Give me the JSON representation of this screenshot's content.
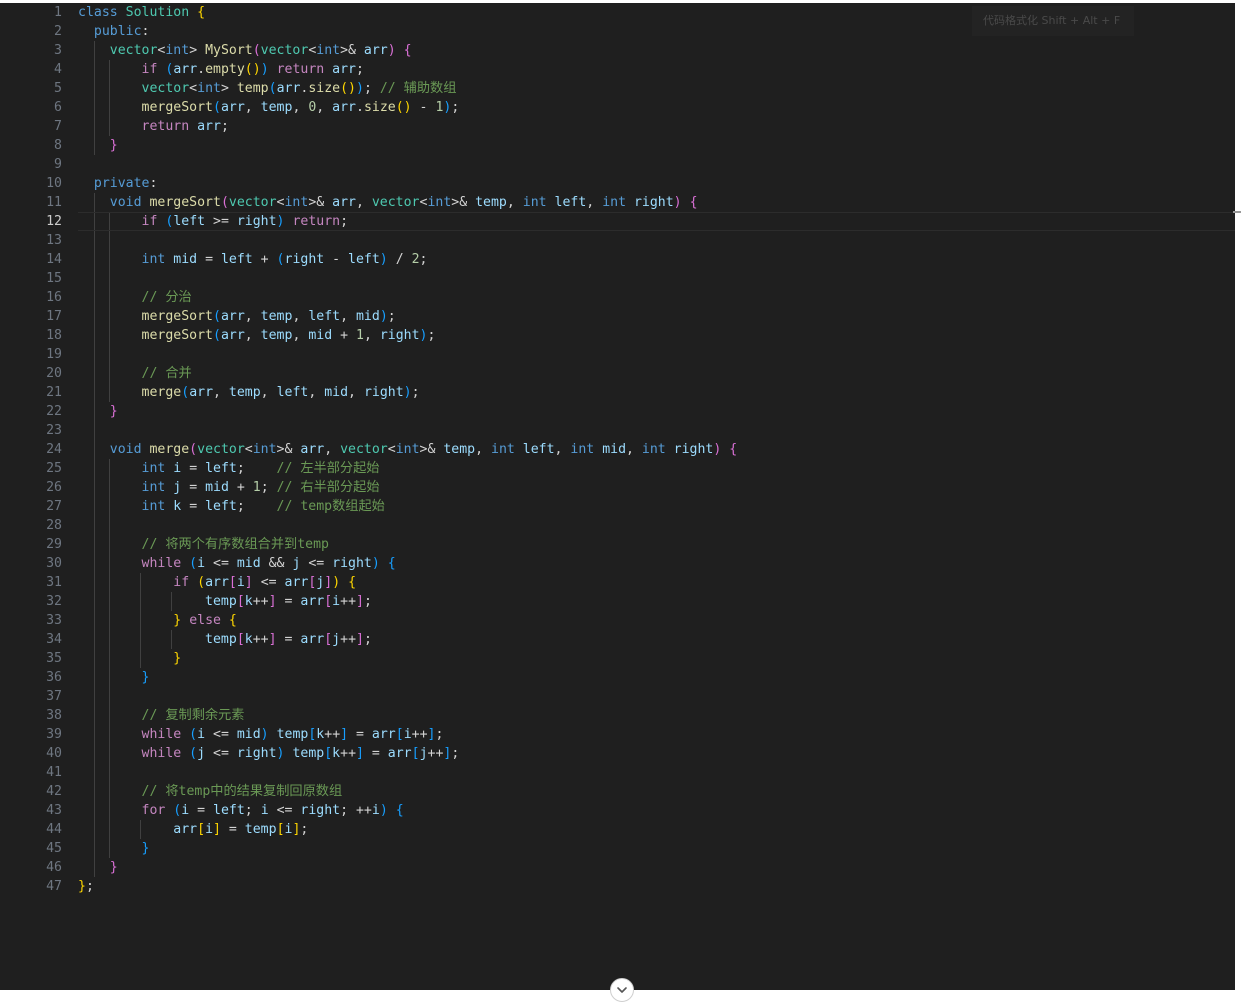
{
  "editor": {
    "hint_text": "代码格式化 Shift + Alt + F",
    "active_line": 12,
    "lines": [
      [
        [
          "kw",
          "class "
        ],
        [
          "typ",
          "Solution "
        ],
        [
          "p1",
          "{"
        ]
      ],
      [
        [
          "op",
          "  "
        ],
        [
          "kw",
          "public"
        ],
        [
          "op",
          ":"
        ]
      ],
      [
        [
          "op",
          "    "
        ],
        [
          "typ",
          "vector"
        ],
        [
          "op",
          "<"
        ],
        [
          "kw",
          "int"
        ],
        [
          "op",
          "> "
        ],
        [
          "fn",
          "MySort"
        ],
        [
          "p2",
          "("
        ],
        [
          "typ",
          "vector"
        ],
        [
          "op",
          "<"
        ],
        [
          "kw",
          "int"
        ],
        [
          "op",
          ">& "
        ],
        [
          "var",
          "arr"
        ],
        [
          "p2",
          ")"
        ],
        [
          "op",
          " "
        ],
        [
          "p2",
          "{"
        ]
      ],
      [
        [
          "op",
          "        "
        ],
        [
          "ctl",
          "if "
        ],
        [
          "p3",
          "("
        ],
        [
          "var",
          "arr"
        ],
        [
          "op",
          "."
        ],
        [
          "fn",
          "empty"
        ],
        [
          "p1",
          "()"
        ],
        [
          "p3",
          ")"
        ],
        [
          "op",
          " "
        ],
        [
          "ctl",
          "return "
        ],
        [
          "var",
          "arr"
        ],
        [
          "op",
          ";"
        ]
      ],
      [
        [
          "op",
          "        "
        ],
        [
          "typ",
          "vector"
        ],
        [
          "op",
          "<"
        ],
        [
          "kw",
          "int"
        ],
        [
          "op",
          "> "
        ],
        [
          "fn",
          "temp"
        ],
        [
          "p3",
          "("
        ],
        [
          "var",
          "arr"
        ],
        [
          "op",
          "."
        ],
        [
          "fn",
          "size"
        ],
        [
          "p1",
          "()"
        ],
        [
          "p3",
          ")"
        ],
        [
          "op",
          "; "
        ],
        [
          "cm",
          "// 辅助数组"
        ]
      ],
      [
        [
          "op",
          "        "
        ],
        [
          "fn",
          "mergeSort"
        ],
        [
          "p3",
          "("
        ],
        [
          "var",
          "arr"
        ],
        [
          "op",
          ", "
        ],
        [
          "var",
          "temp"
        ],
        [
          "op",
          ", "
        ],
        [
          "num",
          "0"
        ],
        [
          "op",
          ", "
        ],
        [
          "var",
          "arr"
        ],
        [
          "op",
          "."
        ],
        [
          "fn",
          "size"
        ],
        [
          "p1",
          "()"
        ],
        [
          "op",
          " - "
        ],
        [
          "num",
          "1"
        ],
        [
          "p3",
          ")"
        ],
        [
          "op",
          ";"
        ]
      ],
      [
        [
          "op",
          "        "
        ],
        [
          "ctl",
          "return "
        ],
        [
          "var",
          "arr"
        ],
        [
          "op",
          ";"
        ]
      ],
      [
        [
          "op",
          "    "
        ],
        [
          "p2",
          "}"
        ]
      ],
      [],
      [
        [
          "op",
          "  "
        ],
        [
          "kw",
          "private"
        ],
        [
          "op",
          ":"
        ]
      ],
      [
        [
          "op",
          "    "
        ],
        [
          "kw",
          "void "
        ],
        [
          "fn",
          "mergeSort"
        ],
        [
          "p2",
          "("
        ],
        [
          "typ",
          "vector"
        ],
        [
          "op",
          "<"
        ],
        [
          "kw",
          "int"
        ],
        [
          "op",
          ">& "
        ],
        [
          "var",
          "arr"
        ],
        [
          "op",
          ", "
        ],
        [
          "typ",
          "vector"
        ],
        [
          "op",
          "<"
        ],
        [
          "kw",
          "int"
        ],
        [
          "op",
          ">& "
        ],
        [
          "var",
          "temp"
        ],
        [
          "op",
          ", "
        ],
        [
          "kw",
          "int "
        ],
        [
          "var",
          "left"
        ],
        [
          "op",
          ", "
        ],
        [
          "kw",
          "int "
        ],
        [
          "var",
          "right"
        ],
        [
          "p2",
          ")"
        ],
        [
          "op",
          " "
        ],
        [
          "p2",
          "{"
        ]
      ],
      [
        [
          "op",
          "        "
        ],
        [
          "ctl",
          "if "
        ],
        [
          "p3",
          "("
        ],
        [
          "var",
          "left"
        ],
        [
          "op",
          " >= "
        ],
        [
          "var",
          "right"
        ],
        [
          "p3",
          ")"
        ],
        [
          "op",
          " "
        ],
        [
          "ctl",
          "return"
        ],
        [
          "op",
          ";"
        ]
      ],
      [],
      [
        [
          "op",
          "        "
        ],
        [
          "kw",
          "int "
        ],
        [
          "var",
          "mid"
        ],
        [
          "op",
          " = "
        ],
        [
          "var",
          "left"
        ],
        [
          "op",
          " + "
        ],
        [
          "p3",
          "("
        ],
        [
          "var",
          "right"
        ],
        [
          "op",
          " - "
        ],
        [
          "var",
          "left"
        ],
        [
          "p3",
          ")"
        ],
        [
          "op",
          " / "
        ],
        [
          "num",
          "2"
        ],
        [
          "op",
          ";"
        ]
      ],
      [],
      [
        [
          "op",
          "        "
        ],
        [
          "cm",
          "// 分治"
        ]
      ],
      [
        [
          "op",
          "        "
        ],
        [
          "fn",
          "mergeSort"
        ],
        [
          "p3",
          "("
        ],
        [
          "var",
          "arr"
        ],
        [
          "op",
          ", "
        ],
        [
          "var",
          "temp"
        ],
        [
          "op",
          ", "
        ],
        [
          "var",
          "left"
        ],
        [
          "op",
          ", "
        ],
        [
          "var",
          "mid"
        ],
        [
          "p3",
          ")"
        ],
        [
          "op",
          ";"
        ]
      ],
      [
        [
          "op",
          "        "
        ],
        [
          "fn",
          "mergeSort"
        ],
        [
          "p3",
          "("
        ],
        [
          "var",
          "arr"
        ],
        [
          "op",
          ", "
        ],
        [
          "var",
          "temp"
        ],
        [
          "op",
          ", "
        ],
        [
          "var",
          "mid"
        ],
        [
          "op",
          " + "
        ],
        [
          "num",
          "1"
        ],
        [
          "op",
          ", "
        ],
        [
          "var",
          "right"
        ],
        [
          "p3",
          ")"
        ],
        [
          "op",
          ";"
        ]
      ],
      [],
      [
        [
          "op",
          "        "
        ],
        [
          "cm",
          "// 合并"
        ]
      ],
      [
        [
          "op",
          "        "
        ],
        [
          "fn",
          "merge"
        ],
        [
          "p3",
          "("
        ],
        [
          "var",
          "arr"
        ],
        [
          "op",
          ", "
        ],
        [
          "var",
          "temp"
        ],
        [
          "op",
          ", "
        ],
        [
          "var",
          "left"
        ],
        [
          "op",
          ", "
        ],
        [
          "var",
          "mid"
        ],
        [
          "op",
          ", "
        ],
        [
          "var",
          "right"
        ],
        [
          "p3",
          ")"
        ],
        [
          "op",
          ";"
        ]
      ],
      [
        [
          "op",
          "    "
        ],
        [
          "p2",
          "}"
        ]
      ],
      [],
      [
        [
          "op",
          "    "
        ],
        [
          "kw",
          "void "
        ],
        [
          "fn",
          "merge"
        ],
        [
          "p2",
          "("
        ],
        [
          "typ",
          "vector"
        ],
        [
          "op",
          "<"
        ],
        [
          "kw",
          "int"
        ],
        [
          "op",
          ">& "
        ],
        [
          "var",
          "arr"
        ],
        [
          "op",
          ", "
        ],
        [
          "typ",
          "vector"
        ],
        [
          "op",
          "<"
        ],
        [
          "kw",
          "int"
        ],
        [
          "op",
          ">& "
        ],
        [
          "var",
          "temp"
        ],
        [
          "op",
          ", "
        ],
        [
          "kw",
          "int "
        ],
        [
          "var",
          "left"
        ],
        [
          "op",
          ", "
        ],
        [
          "kw",
          "int "
        ],
        [
          "var",
          "mid"
        ],
        [
          "op",
          ", "
        ],
        [
          "kw",
          "int "
        ],
        [
          "var",
          "right"
        ],
        [
          "p2",
          ")"
        ],
        [
          "op",
          " "
        ],
        [
          "p2",
          "{"
        ]
      ],
      [
        [
          "op",
          "        "
        ],
        [
          "kw",
          "int "
        ],
        [
          "var",
          "i"
        ],
        [
          "op",
          " = "
        ],
        [
          "var",
          "left"
        ],
        [
          "op",
          ";    "
        ],
        [
          "cm",
          "// 左半部分起始"
        ]
      ],
      [
        [
          "op",
          "        "
        ],
        [
          "kw",
          "int "
        ],
        [
          "var",
          "j"
        ],
        [
          "op",
          " = "
        ],
        [
          "var",
          "mid"
        ],
        [
          "op",
          " + "
        ],
        [
          "num",
          "1"
        ],
        [
          "op",
          "; "
        ],
        [
          "cm",
          "// 右半部分起始"
        ]
      ],
      [
        [
          "op",
          "        "
        ],
        [
          "kw",
          "int "
        ],
        [
          "var",
          "k"
        ],
        [
          "op",
          " = "
        ],
        [
          "var",
          "left"
        ],
        [
          "op",
          ";    "
        ],
        [
          "cm",
          "// temp数组起始"
        ]
      ],
      [],
      [
        [
          "op",
          "        "
        ],
        [
          "cm",
          "// 将两个有序数组合并到temp"
        ]
      ],
      [
        [
          "op",
          "        "
        ],
        [
          "ctl",
          "while "
        ],
        [
          "p3",
          "("
        ],
        [
          "var",
          "i"
        ],
        [
          "op",
          " <= "
        ],
        [
          "var",
          "mid"
        ],
        [
          "op",
          " && "
        ],
        [
          "var",
          "j"
        ],
        [
          "op",
          " <= "
        ],
        [
          "var",
          "right"
        ],
        [
          "p3",
          ")"
        ],
        [
          "op",
          " "
        ],
        [
          "p3",
          "{"
        ]
      ],
      [
        [
          "op",
          "            "
        ],
        [
          "ctl",
          "if "
        ],
        [
          "p1",
          "("
        ],
        [
          "var",
          "arr"
        ],
        [
          "p2",
          "["
        ],
        [
          "var",
          "i"
        ],
        [
          "p2",
          "]"
        ],
        [
          "op",
          " <= "
        ],
        [
          "var",
          "arr"
        ],
        [
          "p2",
          "["
        ],
        [
          "var",
          "j"
        ],
        [
          "p2",
          "]"
        ],
        [
          "p1",
          ")"
        ],
        [
          "op",
          " "
        ],
        [
          "p1",
          "{"
        ]
      ],
      [
        [
          "op",
          "                "
        ],
        [
          "var",
          "temp"
        ],
        [
          "p2",
          "["
        ],
        [
          "var",
          "k"
        ],
        [
          "op",
          "++"
        ],
        [
          "p2",
          "]"
        ],
        [
          "op",
          " = "
        ],
        [
          "var",
          "arr"
        ],
        [
          "p2",
          "["
        ],
        [
          "var",
          "i"
        ],
        [
          "op",
          "++"
        ],
        [
          "p2",
          "]"
        ],
        [
          "op",
          ";"
        ]
      ],
      [
        [
          "op",
          "            "
        ],
        [
          "p1",
          "}"
        ],
        [
          "op",
          " "
        ],
        [
          "ctl",
          "else "
        ],
        [
          "p1",
          "{"
        ]
      ],
      [
        [
          "op",
          "                "
        ],
        [
          "var",
          "temp"
        ],
        [
          "p2",
          "["
        ],
        [
          "var",
          "k"
        ],
        [
          "op",
          "++"
        ],
        [
          "p2",
          "]"
        ],
        [
          "op",
          " = "
        ],
        [
          "var",
          "arr"
        ],
        [
          "p2",
          "["
        ],
        [
          "var",
          "j"
        ],
        [
          "op",
          "++"
        ],
        [
          "p2",
          "]"
        ],
        [
          "op",
          ";"
        ]
      ],
      [
        [
          "op",
          "            "
        ],
        [
          "p1",
          "}"
        ]
      ],
      [
        [
          "op",
          "        "
        ],
        [
          "p3",
          "}"
        ]
      ],
      [],
      [
        [
          "op",
          "        "
        ],
        [
          "cm",
          "// 复制剩余元素"
        ]
      ],
      [
        [
          "op",
          "        "
        ],
        [
          "ctl",
          "while "
        ],
        [
          "p3",
          "("
        ],
        [
          "var",
          "i"
        ],
        [
          "op",
          " <= "
        ],
        [
          "var",
          "mid"
        ],
        [
          "p3",
          ")"
        ],
        [
          "op",
          " "
        ],
        [
          "var",
          "temp"
        ],
        [
          "p3",
          "["
        ],
        [
          "var",
          "k"
        ],
        [
          "op",
          "++"
        ],
        [
          "p3",
          "]"
        ],
        [
          "op",
          " = "
        ],
        [
          "var",
          "arr"
        ],
        [
          "p3",
          "["
        ],
        [
          "var",
          "i"
        ],
        [
          "op",
          "++"
        ],
        [
          "p3",
          "]"
        ],
        [
          "op",
          ";"
        ]
      ],
      [
        [
          "op",
          "        "
        ],
        [
          "ctl",
          "while "
        ],
        [
          "p3",
          "("
        ],
        [
          "var",
          "j"
        ],
        [
          "op",
          " <= "
        ],
        [
          "var",
          "right"
        ],
        [
          "p3",
          ")"
        ],
        [
          "op",
          " "
        ],
        [
          "var",
          "temp"
        ],
        [
          "p3",
          "["
        ],
        [
          "var",
          "k"
        ],
        [
          "op",
          "++"
        ],
        [
          "p3",
          "]"
        ],
        [
          "op",
          " = "
        ],
        [
          "var",
          "arr"
        ],
        [
          "p3",
          "["
        ],
        [
          "var",
          "j"
        ],
        [
          "op",
          "++"
        ],
        [
          "p3",
          "]"
        ],
        [
          "op",
          ";"
        ]
      ],
      [],
      [
        [
          "op",
          "        "
        ],
        [
          "cm",
          "// 将temp中的结果复制回原数组"
        ]
      ],
      [
        [
          "op",
          "        "
        ],
        [
          "ctl",
          "for "
        ],
        [
          "p3",
          "("
        ],
        [
          "var",
          "i"
        ],
        [
          "op",
          " = "
        ],
        [
          "var",
          "left"
        ],
        [
          "op",
          "; "
        ],
        [
          "var",
          "i"
        ],
        [
          "op",
          " <= "
        ],
        [
          "var",
          "right"
        ],
        [
          "op",
          "; ++"
        ],
        [
          "var",
          "i"
        ],
        [
          "p3",
          ")"
        ],
        [
          "op",
          " "
        ],
        [
          "p3",
          "{"
        ]
      ],
      [
        [
          "op",
          "            "
        ],
        [
          "var",
          "arr"
        ],
        [
          "p1",
          "["
        ],
        [
          "var",
          "i"
        ],
        [
          "p1",
          "]"
        ],
        [
          "op",
          " = "
        ],
        [
          "var",
          "temp"
        ],
        [
          "p1",
          "["
        ],
        [
          "var",
          "i"
        ],
        [
          "p1",
          "]"
        ],
        [
          "op",
          ";"
        ]
      ],
      [
        [
          "op",
          "        "
        ],
        [
          "p3",
          "}"
        ]
      ],
      [
        [
          "op",
          "    "
        ],
        [
          "p2",
          "}"
        ]
      ],
      [
        [
          "p1",
          "}"
        ],
        [
          "op",
          ";"
        ]
      ]
    ]
  }
}
